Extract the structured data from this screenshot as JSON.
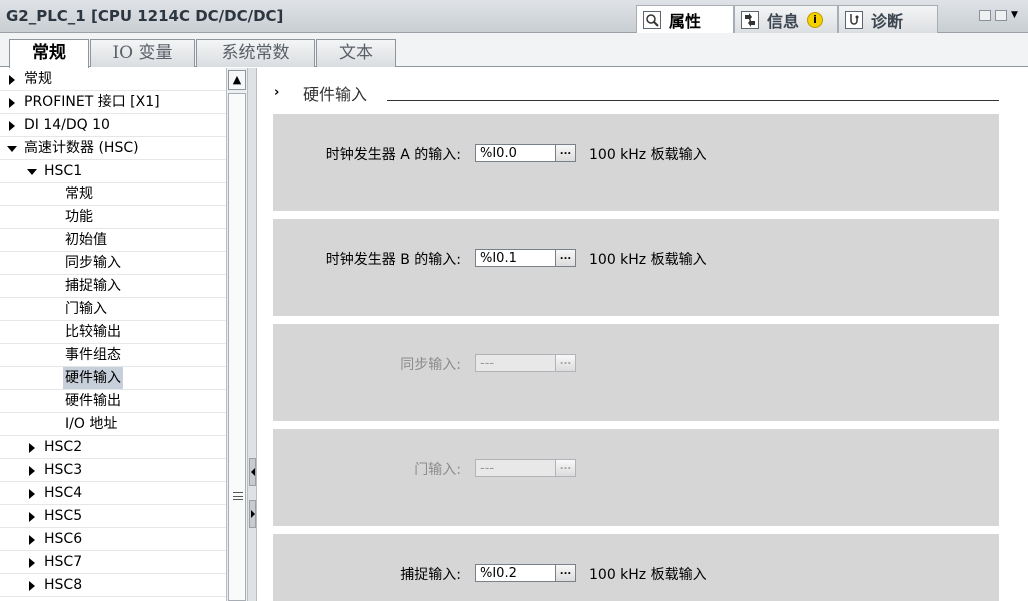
{
  "window": {
    "title": "G2_PLC_1 [CPU 1214C DC/DC/DC]",
    "panel_tabs": [
      {
        "label": "属性",
        "icon": "properties-icon",
        "active": true
      },
      {
        "label": "信息",
        "icon": "info-arrows-icon",
        "badge_icon": "info-badge-icon",
        "badge_text": "i",
        "active": false
      },
      {
        "label": "诊断",
        "icon": "diagnostics-icon",
        "active": false
      }
    ]
  },
  "tabs": [
    {
      "label": "常规",
      "active": true
    },
    {
      "label": "IO 变量",
      "active": false
    },
    {
      "label": "系统常数",
      "active": false
    },
    {
      "label": "文本",
      "active": false
    }
  ],
  "tree": [
    {
      "label": "常规",
      "arrow": "right"
    },
    {
      "label": "PROFINET 接口 [X1]",
      "arrow": "right"
    },
    {
      "label": "DI 14/DQ 10",
      "arrow": "right"
    },
    {
      "label": "高速计数器 (HSC)",
      "arrow": "down"
    },
    {
      "label": "HSC1",
      "arrow": "down"
    },
    {
      "label": "常规",
      "arrow": "none"
    },
    {
      "label": "功能",
      "arrow": "none"
    },
    {
      "label": "初始值",
      "arrow": "none"
    },
    {
      "label": "同步输入",
      "arrow": "none"
    },
    {
      "label": "捕捉输入",
      "arrow": "none"
    },
    {
      "label": "门输入",
      "arrow": "none"
    },
    {
      "label": "比较输出",
      "arrow": "none"
    },
    {
      "label": "事件组态",
      "arrow": "none"
    },
    {
      "label": "硬件输入",
      "arrow": "none",
      "selected": true
    },
    {
      "label": "硬件输出",
      "arrow": "none"
    },
    {
      "label": "I/O 地址",
      "arrow": "none"
    },
    {
      "label": "HSC2",
      "arrow": "right"
    },
    {
      "label": "HSC3",
      "arrow": "right"
    },
    {
      "label": "HSC4",
      "arrow": "right"
    },
    {
      "label": "HSC5",
      "arrow": "right"
    },
    {
      "label": "HSC6",
      "arrow": "right"
    },
    {
      "label": "HSC7",
      "arrow": "right"
    },
    {
      "label": "HSC8",
      "arrow": "right"
    }
  ],
  "section": {
    "chevron": "›",
    "title": "硬件输入"
  },
  "rows": [
    {
      "label": "时钟发生器 A 的输入:",
      "value": "%I0.0",
      "button": "...",
      "note": "100 kHz 板载输入",
      "enabled": true
    },
    {
      "label": "时钟发生器 B 的输入:",
      "value": "%I0.1",
      "button": "...",
      "note": "100 kHz 板载输入",
      "enabled": true
    },
    {
      "label": "同步输入:",
      "value": "---",
      "button": "...",
      "note": "",
      "enabled": false
    },
    {
      "label": "门输入:",
      "value": "---",
      "button": "...",
      "note": "",
      "enabled": false
    },
    {
      "label": "捕捉输入:",
      "value": "%I0.2",
      "button": "...",
      "note": "100 kHz 板载输入",
      "enabled": true
    }
  ],
  "colors": {
    "panel_bg": "#d6d6d6",
    "selection": "#c7d0da",
    "disabled_text": "#8c8c8c"
  }
}
